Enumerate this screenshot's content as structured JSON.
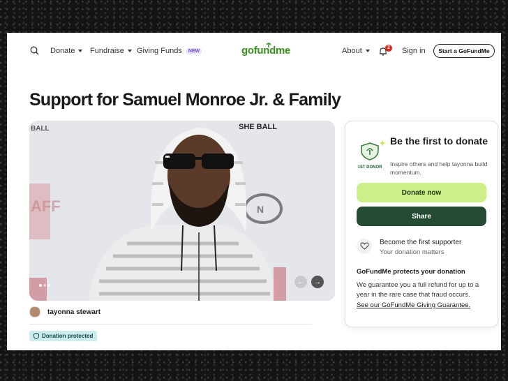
{
  "header": {
    "donate": "Donate",
    "fundraise": "Fundraise",
    "giving_funds": "Giving Funds",
    "new_badge": "NEW",
    "logo": "gofundme",
    "about": "About",
    "notification_count": "2",
    "sign_in": "Sign in",
    "start_button": "Start a GoFundMe"
  },
  "campaign": {
    "title": "Support for Samuel Monroe Jr. & Family",
    "organizer": "tayonna stewart",
    "protected_label": "Donation protected",
    "backdrop_text": "SHE BALL"
  },
  "card": {
    "badge_label": "1ST DONOR",
    "heading": "Be the first to donate",
    "subtext": "Inspire others and help tayonna build momentum.",
    "donate_button": "Donate now",
    "share_button": "Share",
    "supporter_title": "Become the first supporter",
    "supporter_sub": "Your donation matters",
    "protect_heading": "GoFundMe protects your donation",
    "protect_body": "We guarantee you a full refund for up to a year in the rare case that fraud occurs.",
    "protect_link": "See our GoFundMe Giving Guarantee."
  },
  "colors": {
    "brand_green": "#3a8f1f",
    "donate_btn": "#cdf08a",
    "share_btn": "#254a35",
    "badge_red": "#d6261b"
  }
}
